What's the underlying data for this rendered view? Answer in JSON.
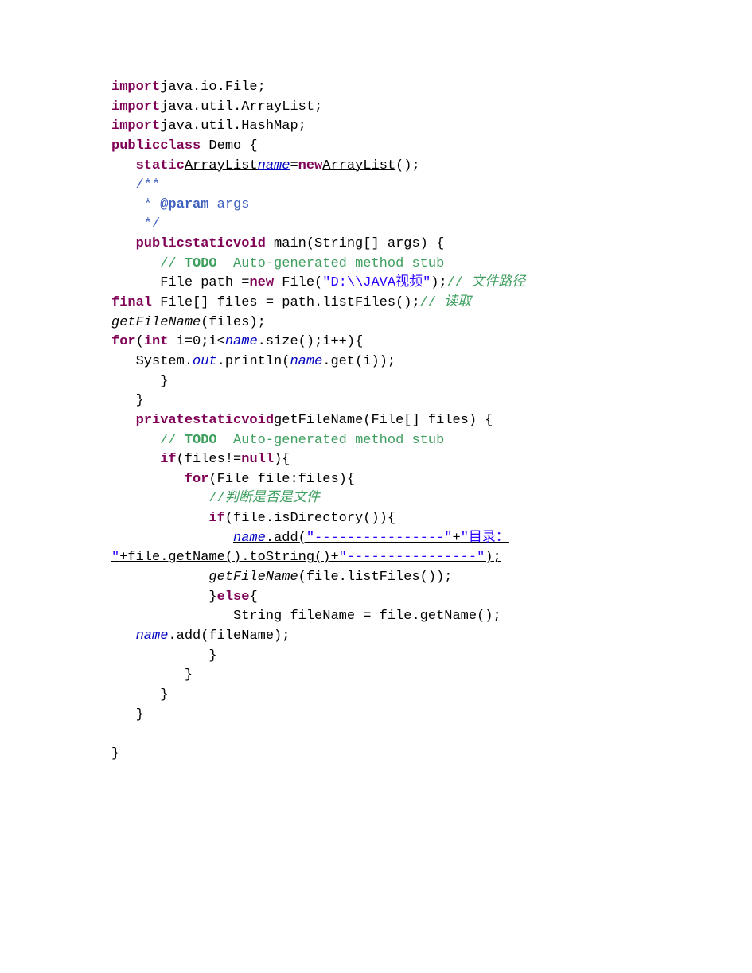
{
  "code": {
    "l1_import": "import",
    "l1_pkg": "java.io.File;",
    "l2_import": "import",
    "l2_pkg": "java.util.ArrayList;",
    "l3_import": "import",
    "l3_pkg": "java.util.HashMap",
    "l3_semicolon": ";",
    "l4_publicclass": "publicclass",
    "l4_rest": " Demo {",
    "l5_static": "static",
    "l5_arraylist1": "ArrayList",
    "l5_name": "name",
    "l5_eq": "=",
    "l5_new": "new",
    "l5_arraylist2": "ArrayList",
    "l5_tail": "();",
    "l6": "/**",
    "l7a": " * ",
    "l7b": "@param",
    "l7c": " args",
    "l8": " */",
    "l9a": "publicstaticvoid",
    "l9b": " main(String[] args) {",
    "l10a": "// ",
    "l10b": "TODO",
    "l10c": "  Auto-generated method stub",
    "l11a": "File path =",
    "l11b": "new",
    "l11c": " File(",
    "l11d": "\"D:\\\\JAVA视频\"",
    "l11e": ");",
    "l11f": "//",
    "l11g": " 文件路径",
    "l12a": "final",
    "l12b": " File[] files = path.listFiles();",
    "l12c": "//",
    "l12d": " 读取",
    "l13a": "getFileName",
    "l13b": "(files);",
    "l14a": "for",
    "l14b": "(",
    "l14c": "int",
    "l14d": " i=0;i<",
    "l14e": "name",
    "l14f": ".size();i++){",
    "l15a": "System.",
    "l15b": "out",
    "l15c": ".println(",
    "l15d": "name",
    "l15e": ".get(i));",
    "l16": "}",
    "l17": "}",
    "l18a": "privatestaticvoid",
    "l18b": "getFileName(File[] files) {",
    "l19a": "// ",
    "l19b": "TODO",
    "l19c": "  Auto-generated method stub",
    "l20a": "if",
    "l20b": "(files!=",
    "l20c": "null",
    "l20d": "){",
    "l21a": "for",
    "l21b": "(File file:files){",
    "l22a": "//",
    "l22b": "判断是否是文件",
    "l23a": "if",
    "l23b": "(file.isDirectory()){",
    "l24a": "name",
    "l24b": ".add(",
    "l24c": "\"----------------\"",
    "l24d": "+",
    "l24e": "\"目录：",
    "l25a": "\"",
    "l25b": "+file.getName().toString()+",
    "l25c": "\"----------------\"",
    "l25d": ");",
    "l26a": "getFileName",
    "l26b": "(file.listFiles());",
    "l27a": "}",
    "l27b": "else",
    "l27c": "{",
    "l28": "String fileName = file.getName();",
    "l29a": "name",
    "l29b": ".add(fileName);",
    "l30": "}",
    "l31": "}",
    "l32": "}",
    "l33": "}",
    "l34": "}"
  }
}
